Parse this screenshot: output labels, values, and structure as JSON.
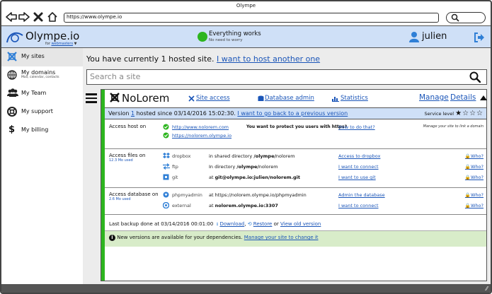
{
  "browser": {
    "title": "Olympe",
    "url": "https://www.olympe.io"
  },
  "header": {
    "brand": "Olympe.io",
    "brand_sub_prefix": "for",
    "brand_sub_link": "webmasters",
    "status_title": "Everything works",
    "status_sub": "No need to worry",
    "status_color": "#2db51f",
    "user": "julien"
  },
  "sidebar": {
    "items": [
      {
        "label": "My sites",
        "sub": "",
        "icon": "sites-icon"
      },
      {
        "label": "My domains",
        "sub": "Mail, calendar, contacts",
        "icon": "globe-icon"
      },
      {
        "label": "My Team",
        "sub": "",
        "icon": "team-icon"
      },
      {
        "label": "My support",
        "sub": "",
        "icon": "lifebuoy-icon"
      },
      {
        "label": "My billing",
        "sub": "",
        "icon": "dollar-icon"
      }
    ]
  },
  "main": {
    "hosted_text": "You have currently 1 hosted site.",
    "hosted_link": "I want to host another one",
    "search_placeholder": "Search a site"
  },
  "site": {
    "name": "NoLorem",
    "links": {
      "site_access": "Site access",
      "database_admin": "Database admin",
      "statistics": "Statistics",
      "manage": "Manage",
      "details": "Details"
    },
    "version": {
      "prefix": "Version",
      "number": "1",
      "text": "hosted since 03/14/2016 15:02:30.",
      "link": "I want to go back to a previous version",
      "service_level_label": "Service level",
      "stars_filled": 1,
      "stars_total": 4
    },
    "access_host": {
      "label": "Access host on",
      "http_url": "http://www.nolorem.com",
      "https_question": "You want to protect you users with https?",
      "https_action": "How to do that?",
      "https_url": "https://nolorem.olympe.io",
      "hint": "Manage your site to link a domain"
    },
    "access_files": {
      "label": "Access files on",
      "sub": "12.3 Mo used",
      "rows": [
        {
          "name": "dropbox",
          "pre": "in shared directory",
          "path": "/olympe/",
          "post": "nolorem",
          "action": "Access to dropbox",
          "who": "Who?"
        },
        {
          "name": "ftp",
          "pre": "In directory",
          "path": "/olympe/",
          "post": "nolorem",
          "action": "I want to connect",
          "who": "Who?"
        },
        {
          "name": "git",
          "pre": "at",
          "path": "git@olympe.io:julien/nolorem.git",
          "post": "",
          "action": "I want to use git",
          "who": "Who?"
        }
      ]
    },
    "access_db": {
      "label": "Access database on",
      "sub": "2.6 Mo used",
      "rows": [
        {
          "name": "phpmyadmin",
          "pre": "at",
          "path": "https://nolorem.olympe.io/phpmyadmin",
          "action": "Admin the database",
          "who": "Who?"
        },
        {
          "name": "external",
          "pre": "at",
          "path": "nolorem.olympe.io:3307",
          "action": "I want to connect",
          "who": "Who?"
        }
      ]
    },
    "backup": {
      "text": "Last backup done at 03/14/2016 00:01:00",
      "download": "Download",
      "restore": "Restore",
      "or": "or",
      "view_old": "View old version"
    },
    "notice": {
      "text": "New versions are available for your dependencies.",
      "link": "Manage your site to change it"
    }
  }
}
